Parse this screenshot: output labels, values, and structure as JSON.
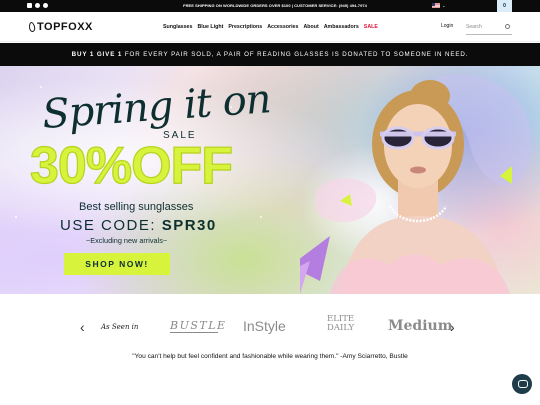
{
  "topbar": {
    "message": "FREE SHIPPING ON WORLDWIDE ORDERS OVER $100 | CUSTOMER SERVICE: (949) 494-7974",
    "locale": "US"
  },
  "nav": {
    "logo": "TOPFOXX",
    "menu": [
      "Sunglasses",
      "Blue Light",
      "Prescriptions",
      "Accessories",
      "About",
      "Ambassadors",
      "SALE"
    ],
    "login": "Login",
    "search_placeholder": "Search",
    "cart_count": "0"
  },
  "promo": {
    "lead": "BUY 1 GIVE 1",
    "text": "FOR EVERY PAIR SOLD, A PAIR OF READING GLASSES IS DONATED TO SOMEONE IN NEED."
  },
  "hero": {
    "headline": "Spring it on",
    "sale": "SALE",
    "discount": "30%OFF",
    "subhead": "Best selling sunglasses",
    "code_label": "USE CODE:",
    "code": "SPR30",
    "exclusion": "~Excluding new arrivals~",
    "cta": "SHOP NOW!"
  },
  "press": {
    "label": "As Seen in",
    "brands": [
      "BUSTLE",
      "InStyle",
      "ELITE DAILY",
      "Medium"
    ],
    "quote": "\"You can't help but feel confident and fashionable while wearing them.\" -Amy Sciarretto, Bustle"
  },
  "colors": {
    "accent": "#d7f33b",
    "dark": "#0b0b0b",
    "sale": "#e0153a",
    "text_teal": "#0d2f2f"
  }
}
